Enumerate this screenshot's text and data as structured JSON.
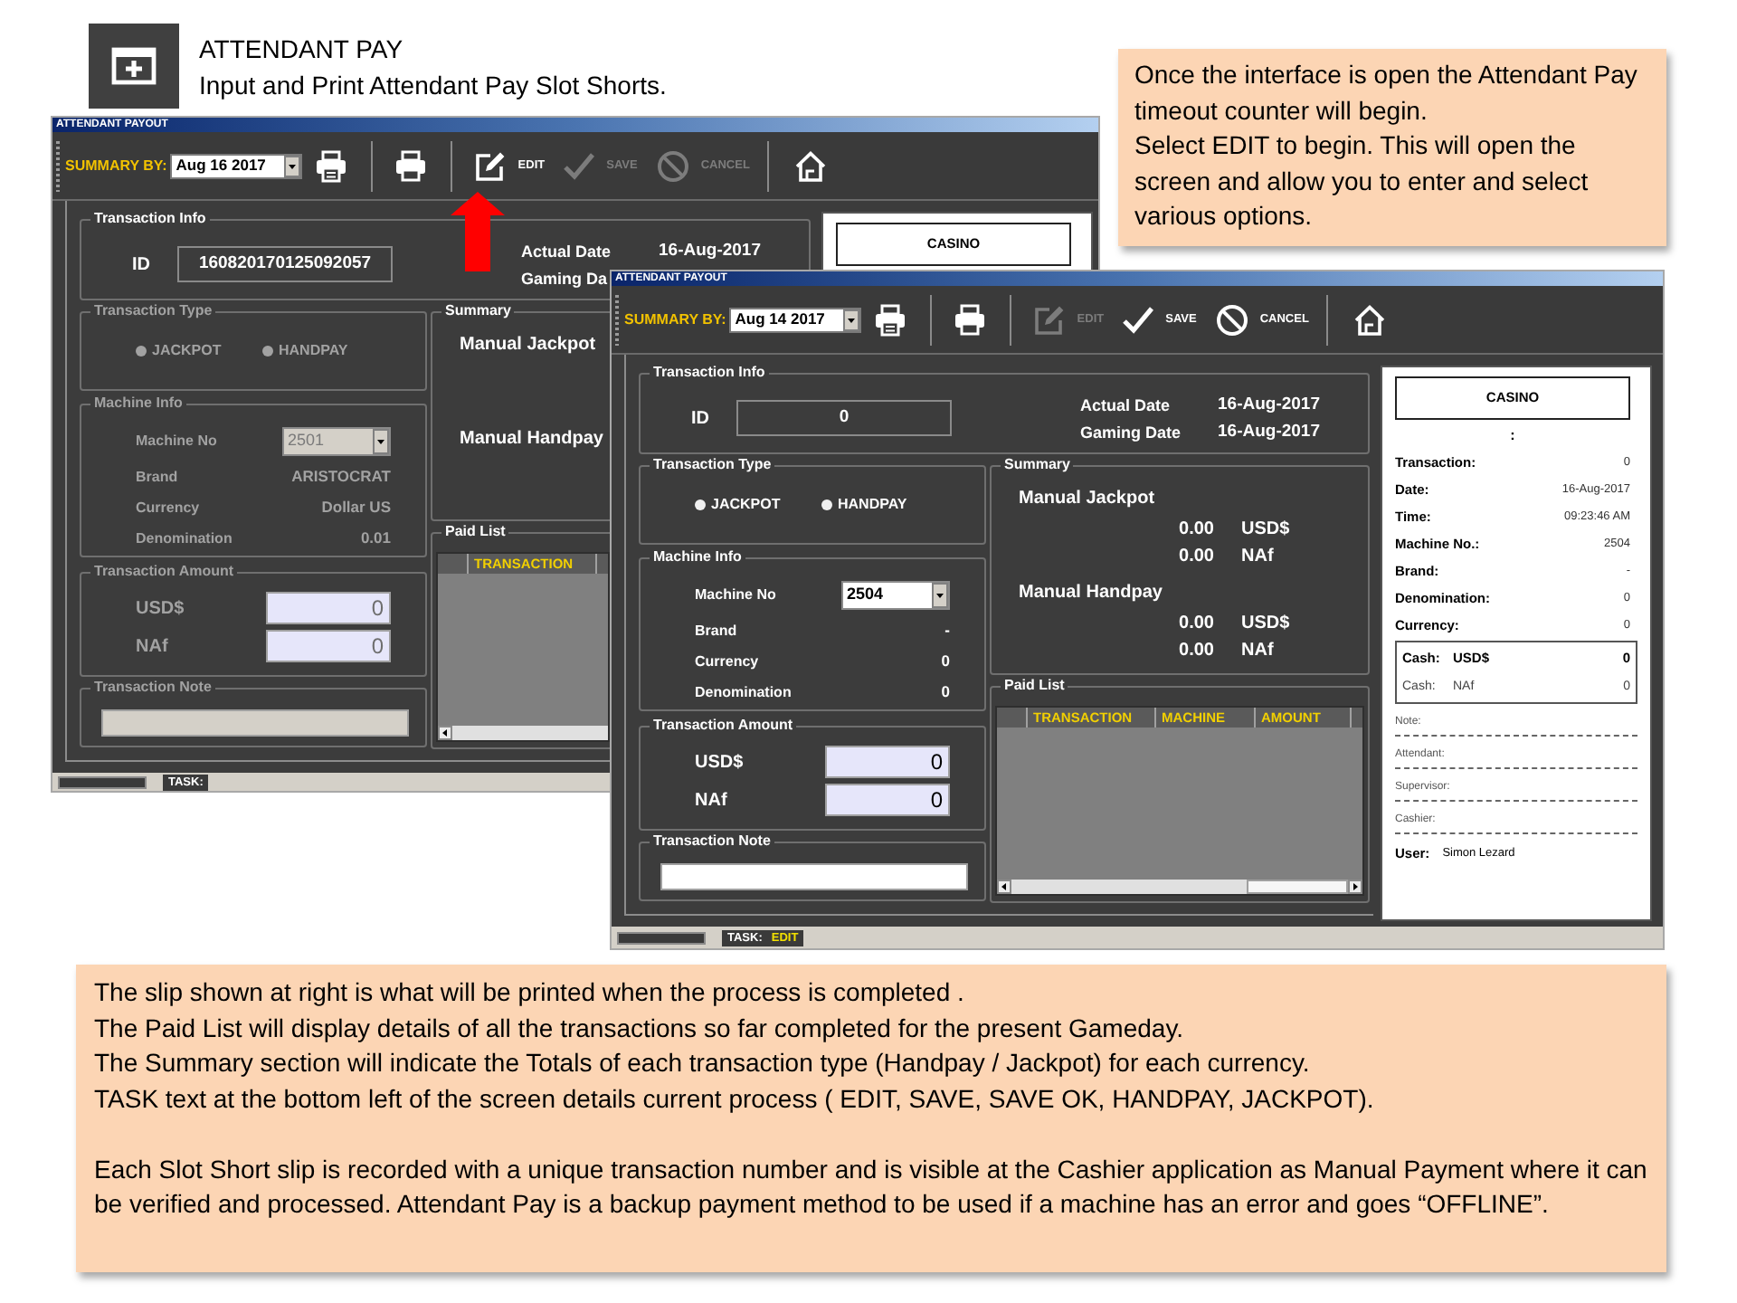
{
  "header": {
    "title": "ATTENDANT PAY",
    "subtitle": "Input and Print Attendant Pay Slot Shorts."
  },
  "callout": {
    "lines": [
      "Once the interface is open the Attendant Pay timeout counter will begin.",
      "Select EDIT to begin. This will open the screen and allow you to enter and select various options."
    ]
  },
  "windows": [
    {
      "title": "ATTENDANT PAYOUT",
      "toolbar": {
        "summary_label": "SUMMARY BY:",
        "date": "Aug 16 2017",
        "actions": [
          {
            "kind": "edit",
            "label": "EDIT",
            "disabled": false
          },
          {
            "kind": "save",
            "label": "SAVE",
            "disabled": true
          },
          {
            "kind": "cancel",
            "label": "CANCEL",
            "disabled": true
          }
        ]
      },
      "transaction_info": {
        "title": "Transaction Info",
        "id_label": "ID",
        "id": "160820170125092057",
        "dates": [
          {
            "label": "Actual Date",
            "value": "16-Aug-2017"
          },
          {
            "label": "Gaming Da"
          }
        ]
      },
      "transaction_type": {
        "title": "Transaction Type",
        "disabled": true,
        "options": [
          {
            "label": "JACKPOT",
            "selected": false
          },
          {
            "label": "HANDPAY",
            "selected": false
          }
        ]
      },
      "machine_info": {
        "title": "Machine Info",
        "disabled": true,
        "machine_label": "Machine No",
        "machine_no": "2501",
        "rows": [
          {
            "label": "Brand",
            "value": "ARISTOCRAT"
          },
          {
            "label": "Currency",
            "value": "Dollar US"
          },
          {
            "label": "Denomination",
            "value": "0.01"
          }
        ]
      },
      "transaction_amount": {
        "title": "Transaction Amount",
        "disabled": true,
        "fields": [
          {
            "label": "USD$",
            "value": "0"
          },
          {
            "label": "NAf",
            "value": "0"
          }
        ]
      },
      "transaction_note": {
        "title": "Transaction Note",
        "disabled": true
      },
      "summary": {
        "title": "Summary",
        "groups": [
          {
            "label": "Manual Jackpot"
          },
          {
            "label": "Manual Handpay"
          }
        ]
      },
      "paid_list": {
        "title": "Paid List",
        "columns": [
          "TRANSACTION"
        ]
      },
      "slip": {
        "header": "CASINO"
      },
      "status_bar": {
        "task_label": "TASK:"
      }
    },
    {
      "title": "ATTENDANT PAYOUT",
      "toolbar": {
        "summary_label": "SUMMARY BY:",
        "date": "Aug 14 2017",
        "actions": [
          {
            "kind": "edit",
            "label": "EDIT",
            "disabled": true
          },
          {
            "kind": "save",
            "label": "SAVE",
            "disabled": false
          },
          {
            "kind": "cancel",
            "label": "CANCEL",
            "disabled": false
          }
        ]
      },
      "transaction_info": {
        "title": "Transaction Info",
        "id_label": "ID",
        "id": "0",
        "dates": [
          {
            "label": "Actual Date",
            "value": "16-Aug-2017"
          },
          {
            "label": "Gaming Date",
            "value": "16-Aug-2017"
          }
        ]
      },
      "transaction_type": {
        "title": "Transaction Type",
        "disabled": false,
        "options": [
          {
            "label": "JACKPOT",
            "selected": false
          },
          {
            "label": "HANDPAY",
            "selected": false
          }
        ]
      },
      "machine_info": {
        "title": "Machine Info",
        "disabled": false,
        "machine_label": "Machine No",
        "machine_no": "2504",
        "rows": [
          {
            "label": "Brand",
            "value": "-"
          },
          {
            "label": "Currency",
            "value": "0"
          },
          {
            "label": "Denomination",
            "value": "0"
          }
        ]
      },
      "transaction_amount": {
        "title": "Transaction Amount",
        "disabled": false,
        "fields": [
          {
            "label": "USD$",
            "value": "0"
          },
          {
            "label": "NAf",
            "value": "0"
          }
        ]
      },
      "transaction_note": {
        "title": "Transaction Note",
        "disabled": false
      },
      "summary": {
        "title": "Summary",
        "groups": [
          {
            "label": "Manual Jackpot",
            "amounts": [
              {
                "value": "0.00",
                "currency": "USD$"
              },
              {
                "value": "0.00",
                "currency": "NAf"
              }
            ]
          },
          {
            "label": "Manual Handpay",
            "amounts": [
              {
                "value": "0.00",
                "currency": "USD$"
              },
              {
                "value": "0.00",
                "currency": "NAf"
              }
            ]
          }
        ]
      },
      "paid_list": {
        "title": "Paid List",
        "columns": [
          "TRANSACTION",
          "MACHINE",
          "AMOUNT"
        ]
      },
      "slip": {
        "header": "CASINO",
        "separator": ":",
        "rows": [
          {
            "label": "Transaction:",
            "value": "0"
          },
          {
            "label": "Date:",
            "value": "16-Aug-2017"
          },
          {
            "label": "Time:",
            "value": "09:23:46 AM"
          },
          {
            "label": "Machine No.:",
            "value": "2504"
          },
          {
            "label": "Brand:",
            "value": "-"
          },
          {
            "label": "Denomination:",
            "value": "0"
          },
          {
            "label": "Currency:",
            "value": "0"
          }
        ],
        "cash": [
          {
            "label": "Cash:",
            "currency": "USD$",
            "value": "0",
            "bold": true
          },
          {
            "label": "Cash:",
            "currency": "NAf",
            "value": "0",
            "bold": false
          }
        ],
        "signatures": [
          "Note:",
          "Attendant:",
          "Supervisor:",
          "Cashier:"
        ],
        "user": {
          "label": "User:",
          "value": "Simon Lezard"
        }
      },
      "status_bar": {
        "task_label": "TASK:",
        "task": "EDIT"
      }
    }
  ],
  "explanation": {
    "blocks": [
      {
        "lines": [
          "The slip shown at right is what will be printed when the process is completed .",
          "The Paid List will display details of all the transactions so far completed for the present Gameday.",
          "The Summary section will indicate the Totals of each transaction type (Handpay / Jackpot) for each currency.",
          "TASK text at the bottom left of the screen details current process ( EDIT, SAVE, SAVE OK, HANDPAY, JACKPOT)."
        ]
      },
      {
        "lines": [
          "Each Slot Short slip is recorded with a unique transaction number and is visible at the Cashier application as Manual Payment where it can be verified and processed. Attendant Pay is a backup payment method to be used if a machine has an error and goes “OFFLINE”."
        ]
      }
    ]
  }
}
